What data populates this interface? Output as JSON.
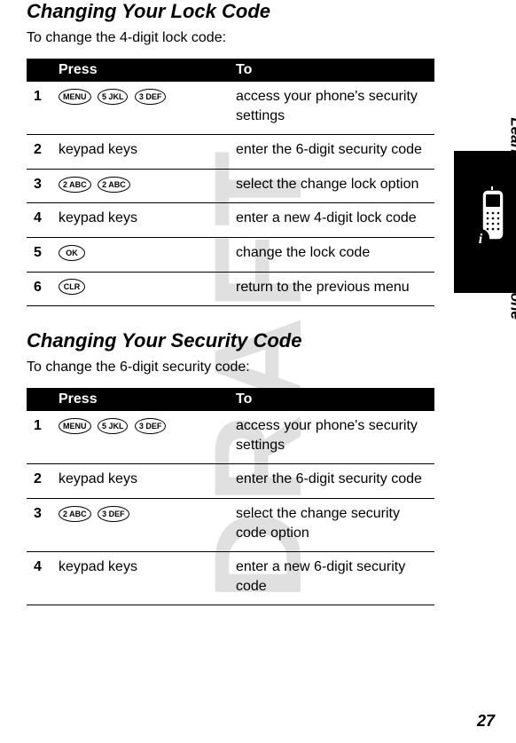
{
  "watermark": "DRAFT",
  "section_label": "Learning to Use Your Phone",
  "page_number": "27",
  "section1": {
    "heading": "Changing Your Lock Code",
    "intro": "To change the 4-digit lock code:",
    "headers": {
      "press": "Press",
      "to": "To"
    },
    "rows": [
      {
        "step": "1",
        "keys": [
          "MENU",
          "5 JKL",
          "3 DEF"
        ],
        "to": "access your phone's security settings"
      },
      {
        "step": "2",
        "press_text": "keypad keys",
        "to": "enter the 6-digit security code"
      },
      {
        "step": "3",
        "keys": [
          "2 ABC",
          "2 ABC"
        ],
        "to": "select the change lock option"
      },
      {
        "step": "4",
        "press_text": "keypad keys",
        "to": "enter a new 4-digit lock code"
      },
      {
        "step": "5",
        "keys": [
          "OK"
        ],
        "to": "change the lock code"
      },
      {
        "step": "6",
        "keys": [
          "CLR"
        ],
        "to": "return to the previous menu"
      }
    ]
  },
  "section2": {
    "heading": "Changing Your Security Code",
    "intro": "To change the 6-digit security code:",
    "headers": {
      "press": "Press",
      "to": "To"
    },
    "rows": [
      {
        "step": "1",
        "keys": [
          "MENU",
          "5 JKL",
          "3 DEF"
        ],
        "to": "access your phone's security settings"
      },
      {
        "step": "2",
        "press_text": "keypad keys",
        "to": "enter the 6-digit security code"
      },
      {
        "step": "3",
        "keys": [
          "2 ABC",
          "3 DEF"
        ],
        "to": "select the change security code option"
      },
      {
        "step": "4",
        "press_text": "keypad keys",
        "to": "enter a new 6-digit security code"
      }
    ]
  }
}
